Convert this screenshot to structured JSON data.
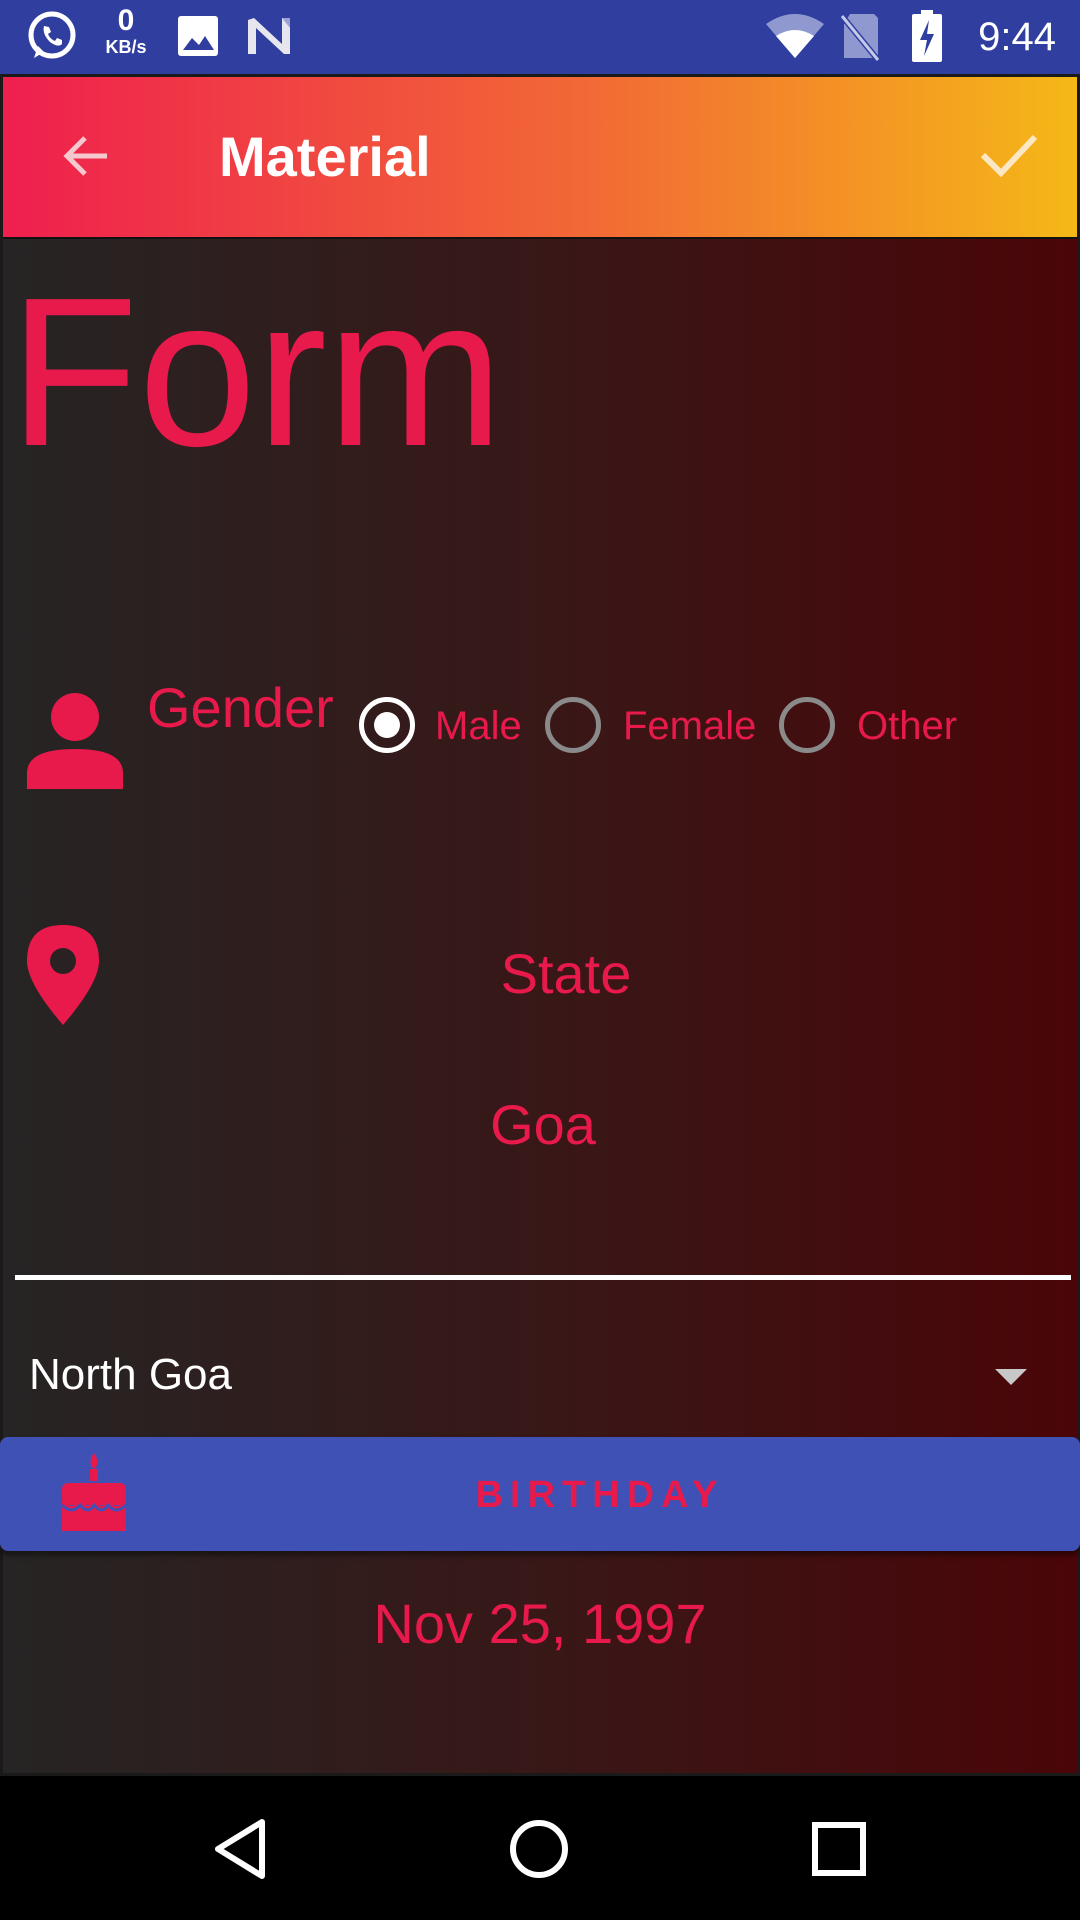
{
  "status_bar": {
    "net_speed_value": "0",
    "net_speed_unit": "KB/s",
    "time": "9:44",
    "icons": [
      "whatsapp-icon",
      "image-icon",
      "n-app-icon",
      "wifi-icon",
      "no-sim-icon",
      "battery-charging-icon"
    ]
  },
  "toolbar": {
    "title": "Material",
    "back_icon": "arrow-back-icon",
    "confirm_icon": "check-icon",
    "gradient_colors": [
      "#ef1f4e",
      "#f26a35",
      "#f5b817"
    ]
  },
  "form": {
    "heading": "Form",
    "gender": {
      "label": "Gender",
      "options": [
        {
          "label": "Male",
          "selected": true
        },
        {
          "label": "Female",
          "selected": false
        },
        {
          "label": "Other",
          "selected": false
        }
      ]
    },
    "state": {
      "label": "State",
      "value": "Goa"
    },
    "district": {
      "selected": "North Goa"
    },
    "birthday": {
      "button_label": "BIRTHDAY",
      "date": "Nov 25, 1997"
    }
  },
  "colors": {
    "accent": "#e8194b",
    "status_bar": "#303f9f",
    "button": "#3f51b5"
  },
  "nav_bar": {
    "icons": [
      "back-triangle-icon",
      "home-circle-icon",
      "recents-square-icon"
    ]
  }
}
